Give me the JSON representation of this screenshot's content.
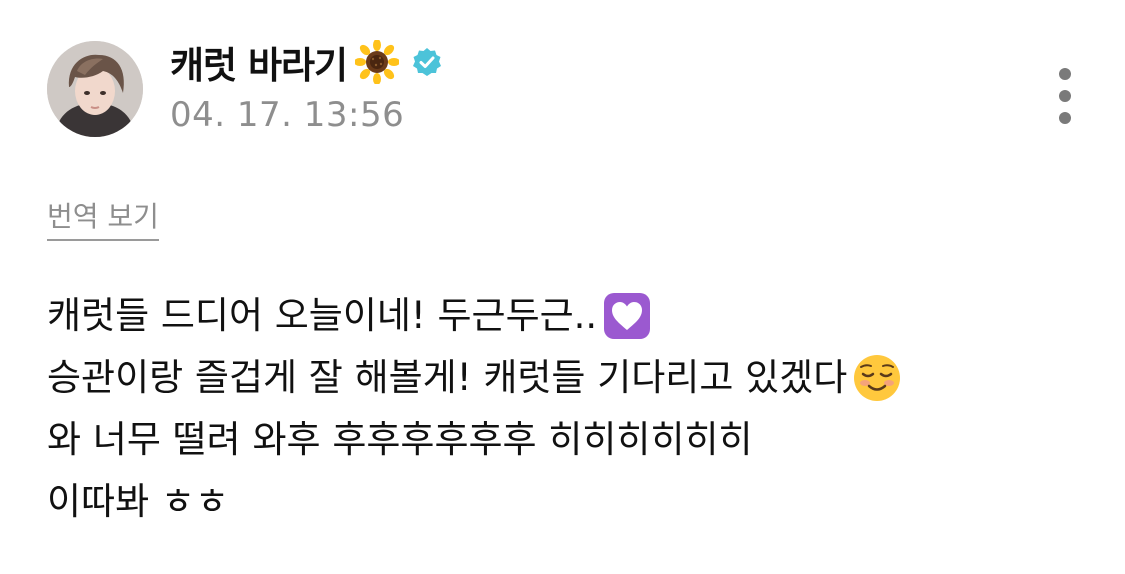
{
  "post": {
    "author_name": "캐럿 바라기",
    "timestamp": "04. 17. 13:56",
    "translate_label": "번역 보기",
    "lines": [
      "캐럿들 드디어 오늘이네! 두근두근..",
      "승관이랑 즐겁게 잘 해볼게! 캐럿들 기다리고 있겠다",
      "와 너무 떨려 와후 후후후후후후 히히히히히히",
      "이따봐 ㅎㅎ"
    ]
  },
  "icons": {
    "avatar": "avatar-photo",
    "name_emoji": "sunflower-icon",
    "badge": "verified-badge-icon",
    "menu": "more-vertical-icon",
    "line1_emoji": "purple-heart-icon",
    "line2_emoji": "smiling-face-icon"
  },
  "colors": {
    "verified_badge": "#4cc3d9",
    "muted_text": "#8e8e8e",
    "heart_purple": "#9b59d0",
    "emoji_yellow": "#ffc83d"
  }
}
